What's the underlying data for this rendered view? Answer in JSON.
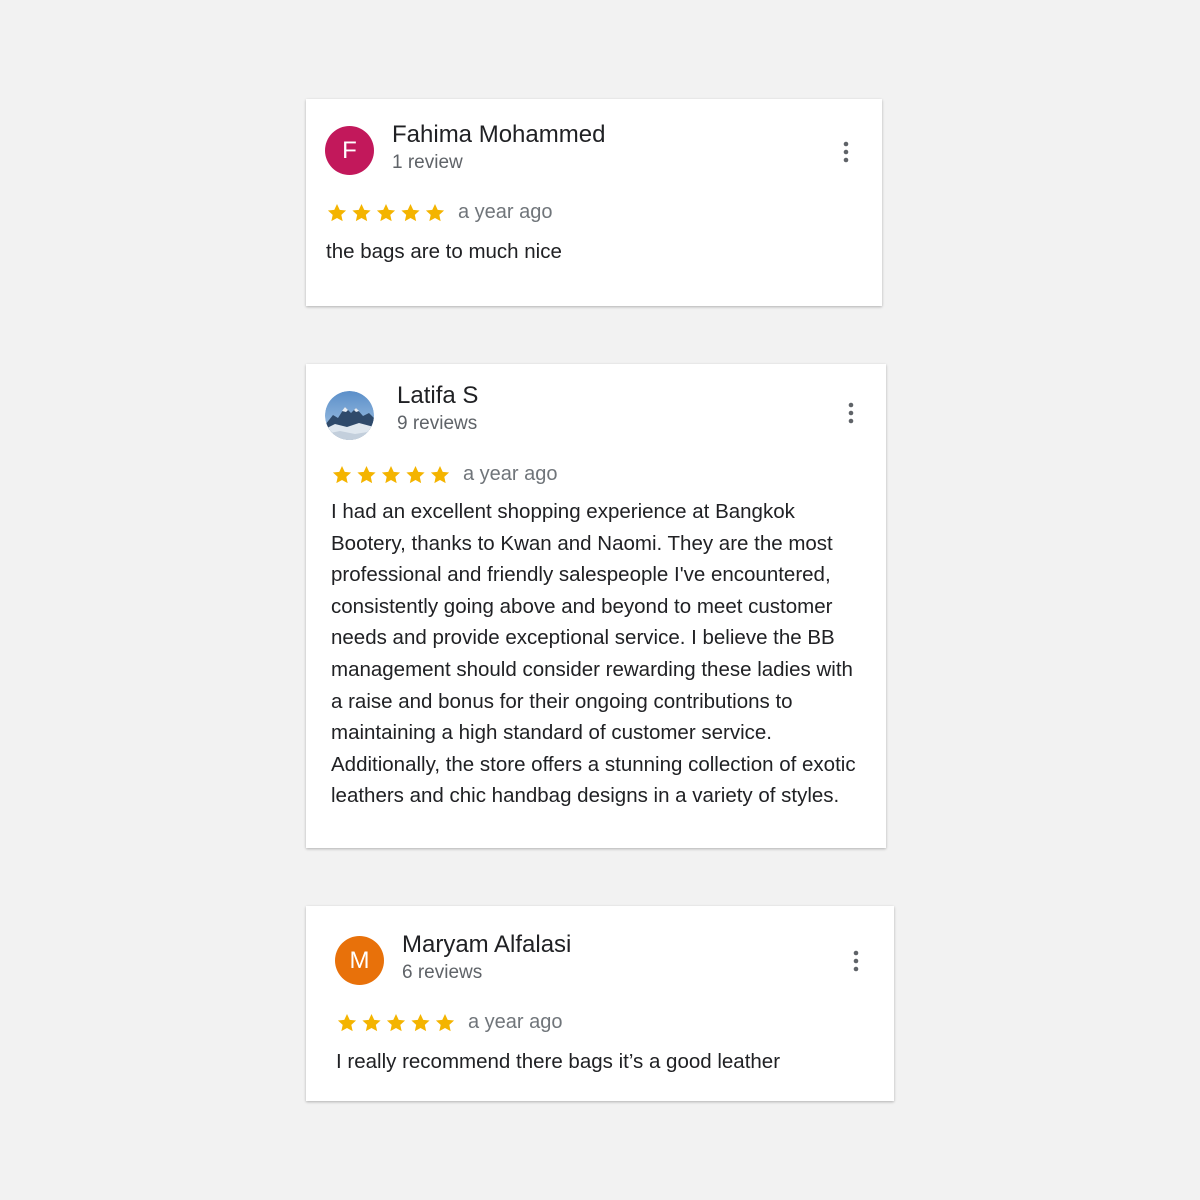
{
  "reviews": [
    {
      "initial": "F",
      "avatar_color": "#c2185b",
      "name": "Fahima Mohammed",
      "review_count": "1 review",
      "rating": 5,
      "date": "a year ago",
      "text": "the bags are to much nice",
      "menu_icon": "more-vert-icon"
    },
    {
      "avatar_icon": "mountain-photo-icon",
      "name": "Latifa S",
      "review_count": "9 reviews",
      "rating": 5,
      "date": "a year ago",
      "text": "I had an excellent shopping experience at Bangkok Bootery, thanks to Kwan and Naomi. They are the most professional and friendly salespeople I've encountered, consistently going above and beyond to meet customer needs and provide exceptional service. I believe the BB management should consider rewarding these ladies with a raise and bonus for their ongoing contributions to maintaining a high standard of customer service. Additionally, the store offers a stunning collection of exotic leathers and chic handbag designs in a variety of styles.",
      "menu_icon": "more-vert-icon"
    },
    {
      "initial": "M",
      "avatar_color": "#e8710a",
      "name": "Maryam Alfalasi",
      "review_count": "6 reviews",
      "rating": 5,
      "date": "a year ago",
      "text": "I really recommend there bags it’s a good leather",
      "menu_icon": "more-vert-icon"
    }
  ],
  "colors": {
    "star": "#f4b400",
    "background": "#f2f2f2",
    "card": "#ffffff"
  }
}
